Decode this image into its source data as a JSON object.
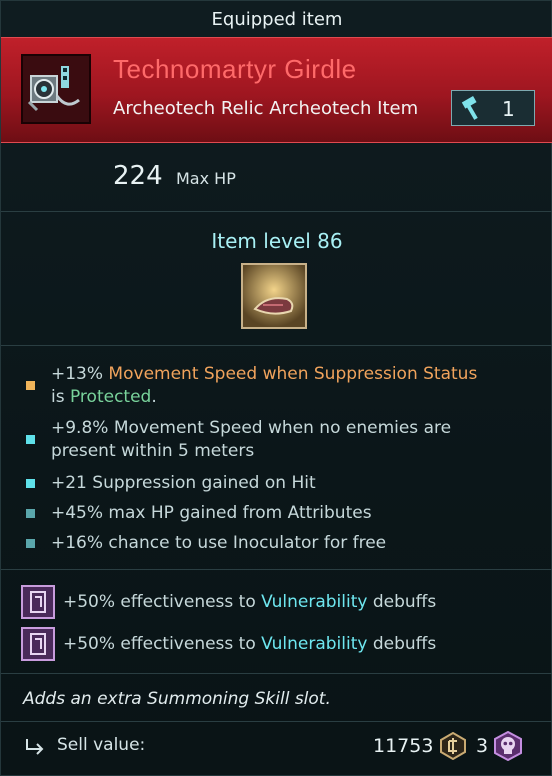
{
  "header": {
    "title": "Equipped item"
  },
  "item": {
    "name": "Technomartyr Girdle",
    "type_line": "Archeotech Relic Archeotech Item",
    "upgrade_count": "1",
    "colors": {
      "title_band": "#b61c25",
      "name": "#ff6a6a"
    }
  },
  "stat": {
    "value": "224",
    "label": "Max HP"
  },
  "item_level": "Item level 86",
  "affixes": [
    {
      "pre": "+13%",
      "text_orange": " Movement Speed when Suppression Status",
      "line2_pre": "is ",
      "line2_green": "Protected",
      "line2_post": ".",
      "bullet": "#f0b45a"
    },
    {
      "line1": "+9.8% Movement Speed when no enemies are",
      "line2": "present within 5 meters",
      "bullet": "#5fe1ea"
    },
    {
      "line1": "+21 Suppression gained on Hit",
      "bullet": "#5fe1ea"
    },
    {
      "line1": "+45% max HP gained from Attributes",
      "bullet": "#5aa6ab"
    },
    {
      "line1": "+16% chance to use Inoculator for free",
      "bullet": "#5aa6ab"
    }
  ],
  "runes": [
    {
      "pre": "+50% effectiveness to ",
      "highlight": "Vulnerability",
      "post": " debuffs"
    },
    {
      "pre": "+50% effectiveness to ",
      "highlight": "Vulnerability",
      "post": " debuffs"
    }
  ],
  "description": "Adds an extra Summoning Skill slot.",
  "sell": {
    "label": "Sell value:",
    "value": "11753",
    "secondary": "3"
  },
  "icons": [
    "item-icon",
    "hammer-icon",
    "relic-slot-icon",
    "rune-icon",
    "sell-arrow-icon",
    "currency-coin-icon",
    "skull-icon"
  ]
}
